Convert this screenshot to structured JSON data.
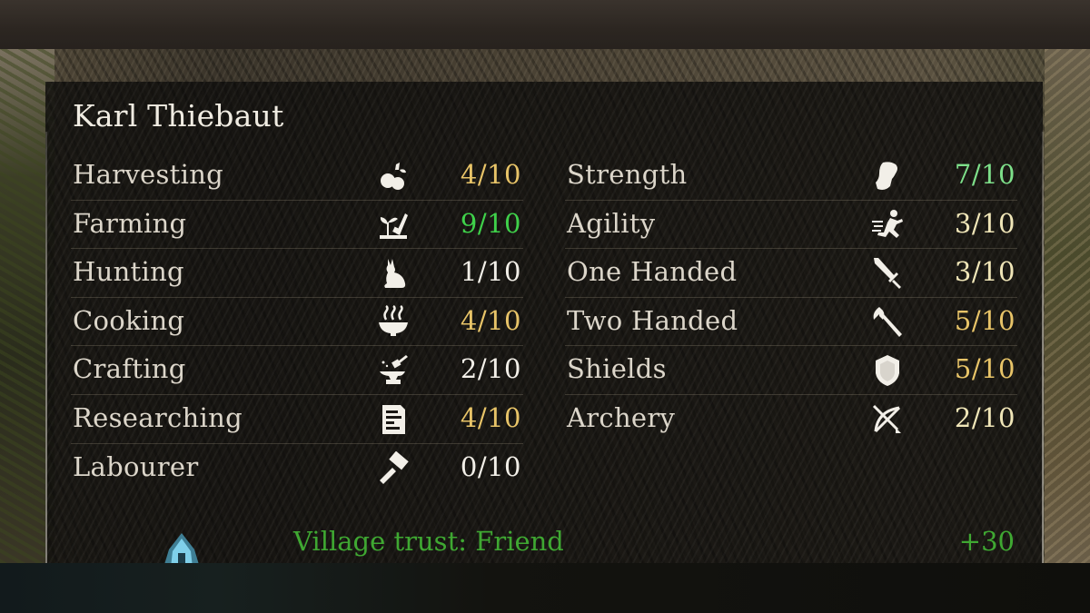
{
  "character": {
    "name": "Karl Thiebaut"
  },
  "colors": {
    "low": "#f2efe8",
    "mid": "#e8c468",
    "high": "#3fd14a",
    "high_alt": "#7ee08a",
    "pale": "#f0e6b8",
    "trust": "#3fa832",
    "label": "#dcd6ca"
  },
  "skills": [
    {
      "label": "Harvesting",
      "icon": "harvesting-icon",
      "value": "4/10",
      "tier": "mid"
    },
    {
      "label": "Farming",
      "icon": "farming-icon",
      "value": "9/10",
      "tier": "high"
    },
    {
      "label": "Hunting",
      "icon": "hunting-icon",
      "value": "1/10",
      "tier": "low"
    },
    {
      "label": "Cooking",
      "icon": "cooking-icon",
      "value": "4/10",
      "tier": "mid"
    },
    {
      "label": "Crafting",
      "icon": "crafting-icon",
      "value": "2/10",
      "tier": "low"
    },
    {
      "label": "Researching",
      "icon": "researching-icon",
      "value": "4/10",
      "tier": "mid"
    },
    {
      "label": "Labourer",
      "icon": "labourer-icon",
      "value": "0/10",
      "tier": "low"
    }
  ],
  "combat": [
    {
      "label": "Strength",
      "icon": "strength-icon",
      "value": "7/10",
      "tier": "high_alt"
    },
    {
      "label": "Agility",
      "icon": "agility-icon",
      "value": "3/10",
      "tier": "pale"
    },
    {
      "label": "One Handed",
      "icon": "one-handed-icon",
      "value": "3/10",
      "tier": "pale"
    },
    {
      "label": "Two Handed",
      "icon": "two-handed-icon",
      "value": "5/10",
      "tier": "mid"
    },
    {
      "label": "Shields",
      "icon": "shields-icon",
      "value": "5/10",
      "tier": "mid"
    },
    {
      "label": "Archery",
      "icon": "archery-icon",
      "value": "2/10",
      "tier": "pale"
    }
  ],
  "trust": {
    "label": "Village trust: Friend",
    "value": "+30",
    "icon": "village-trust-icon"
  }
}
